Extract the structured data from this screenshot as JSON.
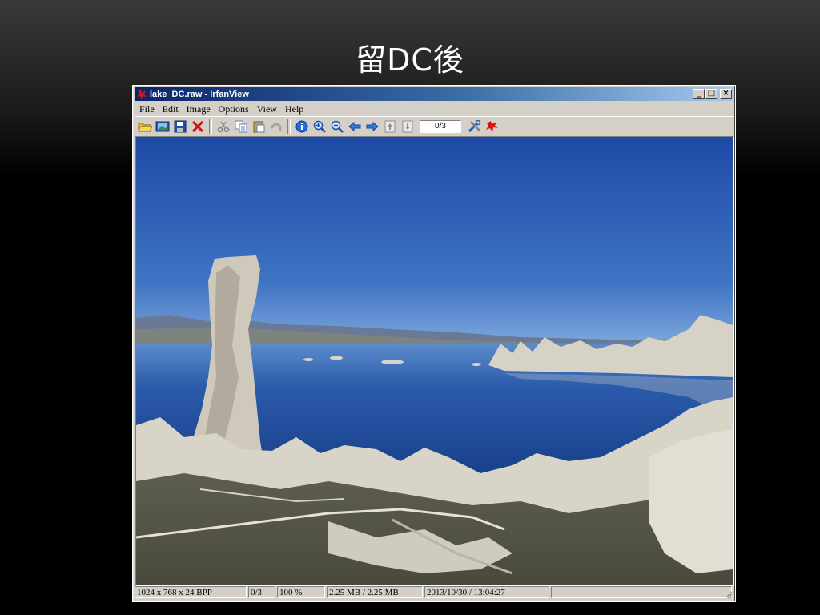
{
  "slide": {
    "title": "留DC後"
  },
  "window": {
    "title": "lake_DC.raw - IrfanView",
    "controls": {
      "minimize": "_",
      "maximize": "□",
      "close": "×"
    }
  },
  "menu": {
    "items": [
      "File",
      "Edit",
      "Image",
      "Options",
      "View",
      "Help"
    ]
  },
  "toolbar": {
    "page_indicator": "0/3",
    "buttons": [
      "open-folder-icon",
      "slideshow-icon",
      "save-icon",
      "delete-icon",
      "cut-icon",
      "copy-icon",
      "paste-icon",
      "undo-icon",
      "info-icon",
      "zoom-in-icon",
      "zoom-out-icon",
      "previous-icon",
      "next-icon",
      "first-page-icon",
      "last-page-icon",
      "properties-icon",
      "exit-icon"
    ]
  },
  "statusbar": {
    "dimensions": "1024 x 768 x 24 BPP",
    "page": "0/3",
    "zoom": "100 %",
    "size": "2.25 MB / 2.25 MB",
    "datetime": "2013/10/30 / 13:04:27"
  },
  "colors": {
    "titlebar_start": "#0a246a",
    "titlebar_end": "#a6caf0",
    "chrome": "#d4d0c8",
    "sky": "#1f4fa8",
    "water": "#1a3f8a"
  }
}
